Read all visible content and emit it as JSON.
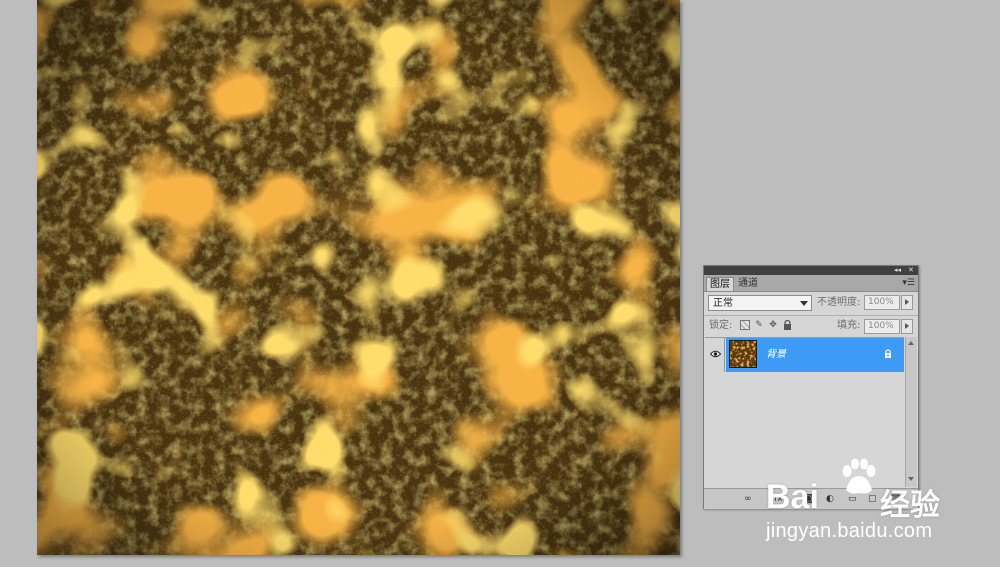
{
  "canvas": {
    "content": "lava-texture",
    "colors": {
      "dark": "#4a3410",
      "olive": "#6e5a1f",
      "orange": "#e0750f",
      "hot": "#ffb020"
    }
  },
  "layers_panel": {
    "tabs": [
      {
        "label": "图层",
        "active": true
      },
      {
        "label": "通道",
        "active": false
      }
    ],
    "collapse_icon": "double-chevron-icon",
    "close_icon": "close-icon",
    "menu_icon": "panel-menu-icon",
    "blend_mode": "正常",
    "opacity_label": "不透明度:",
    "opacity_value": "100%",
    "lock_label": "锁定:",
    "fill_label": "填充:",
    "fill_value": "100%",
    "lock_icons": [
      "lock-transparent-icon",
      "lock-paint-icon",
      "lock-move-icon",
      "lock-all-icon"
    ],
    "layers": [
      {
        "name": "背景",
        "visible": true,
        "locked": true,
        "selected": true
      }
    ],
    "selection_color": "#3d9bf5"
  },
  "watermark": {
    "brand_latin": "Bai",
    "brand_cn": "经验",
    "url": "jingyan.baidu.com"
  }
}
